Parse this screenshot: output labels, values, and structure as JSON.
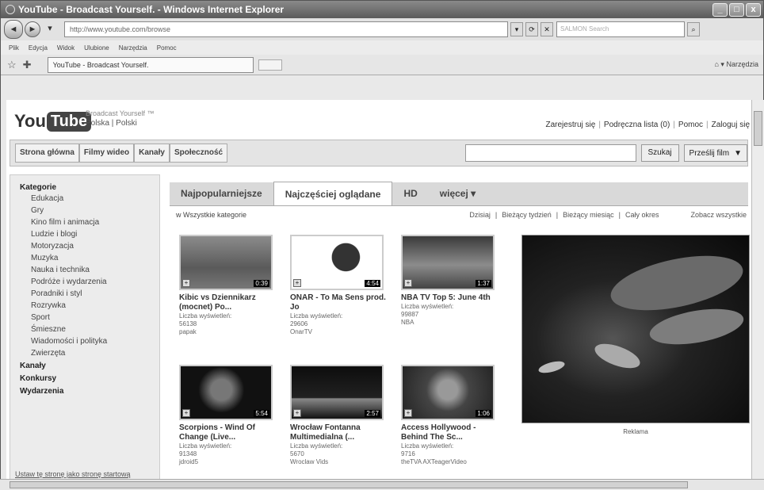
{
  "window": {
    "title": "YouTube - Broadcast Yourself. - Windows Internet Explorer"
  },
  "browser": {
    "url": "http://www.youtube.com/browse",
    "search_placeholder": "SALMON Search",
    "menu": [
      "Plik",
      "Edycja",
      "Widok",
      "Ulubione",
      "Narzędzia",
      "Pomoc"
    ],
    "tab_title": "YouTube - Broadcast Yourself.",
    "tools_label": "Narzędzia"
  },
  "youtube": {
    "logo_you": "You",
    "logo_tube": "Tube",
    "tagline": "Broadcast Yourself ™",
    "locale": "Polska | Polski",
    "user_links": [
      "Zarejestruj się",
      "Podręczna lista (0)",
      "Pomoc",
      "Zaloguj się"
    ],
    "nav": [
      "Strona główna",
      "Filmy wideo",
      "Kanały",
      "Społeczność"
    ],
    "search_button": "Szukaj",
    "upload_button": "Prześlij film",
    "sidebar": {
      "categories_title": "Kategorie",
      "categories": [
        "Edukacja",
        "Gry",
        "Kino film i animacja",
        "Ludzie i blogi",
        "Motoryzacja",
        "Muzyka",
        "Nauka i technika",
        "Podróże i wydarzenia",
        "Poradniki i styl",
        "Rozrywka",
        "Sport",
        "Śmieszne",
        "Wiadomości i polityka",
        "Zwierzęta"
      ],
      "sections": [
        "Kanały",
        "Konkursy",
        "Wydarzenia"
      ],
      "footer": "Ustaw tę stronę jako stronę startową"
    },
    "tabs": [
      "Najpopularniejsze",
      "Najczęściej oglądane",
      "HD",
      "więcej ▾"
    ],
    "filter_category": "w Wszystkie kategorie",
    "time_filters": [
      "Dzisiaj",
      "Bieżący tydzień",
      "Bieżący miesiąc",
      "Cały okres"
    ],
    "see_all": "Zobacz wszystkie",
    "videos": [
      {
        "title": "Kibic vs Dziennikarz (mocnet) Po...",
        "views_label": "Liczba wyświetleń:",
        "views": "56138",
        "user": "papak",
        "duration": "0:39"
      },
      {
        "title": "ONAR - To Ma Sens prod. Jo",
        "views_label": "Liczba wyświetleń:",
        "views": "29606",
        "user": "OnarTV",
        "duration": "4:54"
      },
      {
        "title": "NBA TV Top 5: June 4th",
        "views_label": "Liczba wyświetleń:",
        "views": "99887",
        "user": "NBA",
        "duration": "1:37"
      },
      {
        "title": "Scorpions - Wind Of Change (Live...",
        "views_label": "Liczba wyświetleń:",
        "views": "91348",
        "user": "jdroid5",
        "duration": "5:54"
      },
      {
        "title": "Wrocław Fontanna Multimedialna (...",
        "views_label": "Liczba wyświetleń:",
        "views": "5670",
        "user": "Wroclaw Vids",
        "duration": "2:57"
      },
      {
        "title": "Access Hollywood - Behind The Sc...",
        "views_label": "Liczba wyświetleń:",
        "views": "9716",
        "user": "theTVA AXTeagerVideo",
        "duration": "1:06"
      }
    ],
    "feature_caption": "Reklama"
  }
}
